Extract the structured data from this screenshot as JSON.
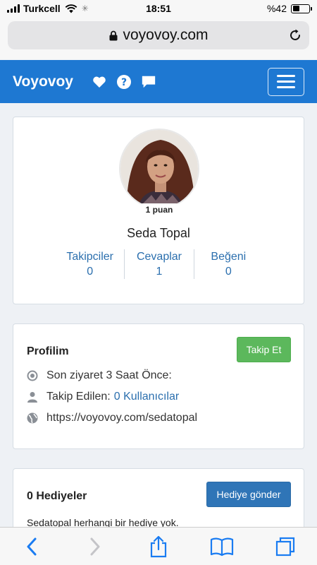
{
  "status_bar": {
    "carrier": "Turkcell",
    "time": "18:51",
    "battery": "%42",
    "battery_level": 0.42
  },
  "browser": {
    "url": "voyovoy.com"
  },
  "navbar": {
    "brand": "Voyovoy"
  },
  "profile": {
    "points_badge": "1 puan",
    "name": "Seda Topal",
    "stats": [
      {
        "label": "Takipciler",
        "value": "0"
      },
      {
        "label": "Cevaplar",
        "value": "1"
      },
      {
        "label": "Beğeni",
        "value": "0"
      }
    ]
  },
  "profile_info": {
    "title": "Profilim",
    "follow_button": "Takip Et",
    "last_visit": "Son ziyaret 3 Saat Önce:",
    "following_label": "Takip Edilen:",
    "following_link": "0 Kullanıcılar",
    "profile_url": "https://voyovoy.com/sedatopal"
  },
  "gifts": {
    "title": "0 Hediyeler",
    "send_button": "Hediye gönder",
    "empty_text": "Sedatopal herhangi bir hediye yok."
  },
  "colors": {
    "navbar": "#1e78d2",
    "link": "#2b6fae",
    "success": "#5cb85c",
    "primary": "#2f75b7",
    "ios_blue": "#1a7cf2"
  }
}
